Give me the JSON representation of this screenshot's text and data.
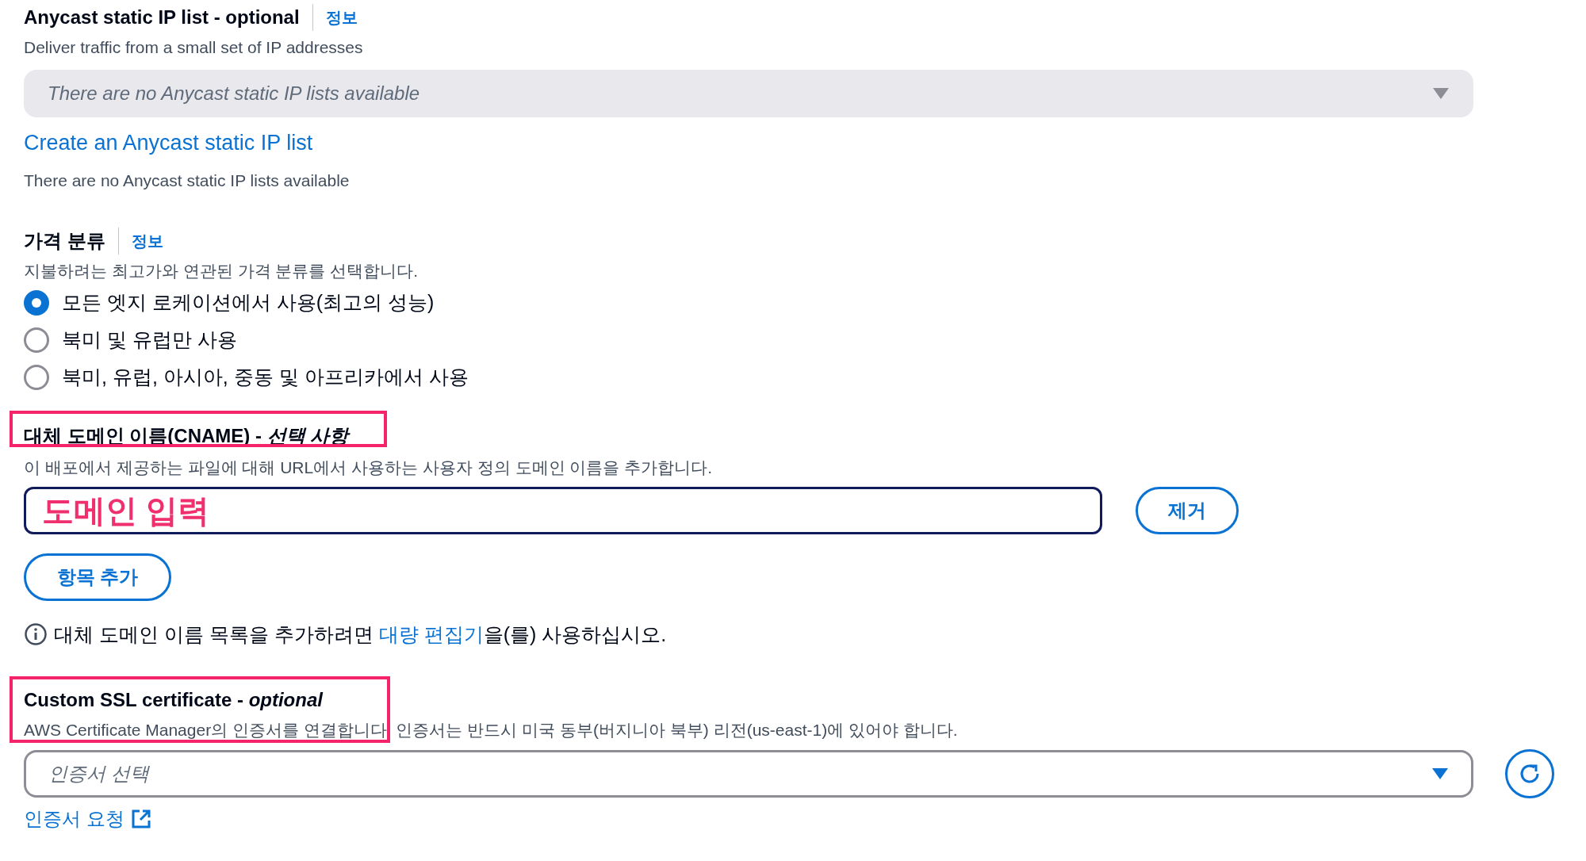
{
  "anycast": {
    "title": "Anycast static IP list - optional",
    "info": "정보",
    "description": "Deliver traffic from a small set of IP addresses",
    "select": {
      "placeholder": "There are no Anycast static IP lists available",
      "disabled": true
    },
    "create_link": "Create an Anycast static IP list",
    "note": "There are no Anycast static IP lists available"
  },
  "price_class": {
    "title": "가격 분류",
    "info": "정보",
    "description": "지불하려는 최고가와 연관된 가격 분류를 선택합니다.",
    "options": [
      {
        "label": "모든 엣지 로케이션에서 사용(최고의 성능)",
        "selected": true
      },
      {
        "label": "북미 및 유럽만 사용",
        "selected": false
      },
      {
        "label": "북미, 유럽, 아시아, 중동 및 아프리카에서 사용",
        "selected": false
      }
    ]
  },
  "cname": {
    "title": "대체 도메인 이름(CNAME) - *선택 사항*",
    "highlighted": true,
    "description": "이 배포에서 제공하는 파일에 대해 URL에서 사용하는 사용자 정의 도메인 이름을 추가합니다.",
    "items": [
      {
        "value": "도메인 입력",
        "remove_button": "제거"
      }
    ],
    "add_button": "항목 추가",
    "info_before": "대체 도메인 이름 목록을 추가하려면",
    "info_link": "대량 편집기",
    "info_after": "을(를) 사용하십시오."
  },
  "ssl": {
    "title": "Custom SSL certificate - *optional*",
    "highlighted": true,
    "description": "AWS Certificate Manager의 인증서를 연결합니다. 인증서는 반드시 미국 동부(버지니아 북부) 리전(us-east-1)에 있어야 합니다.",
    "select": {
      "placeholder": "인증서 선택",
      "disabled": false
    },
    "request_link": "인증서 요청"
  }
}
